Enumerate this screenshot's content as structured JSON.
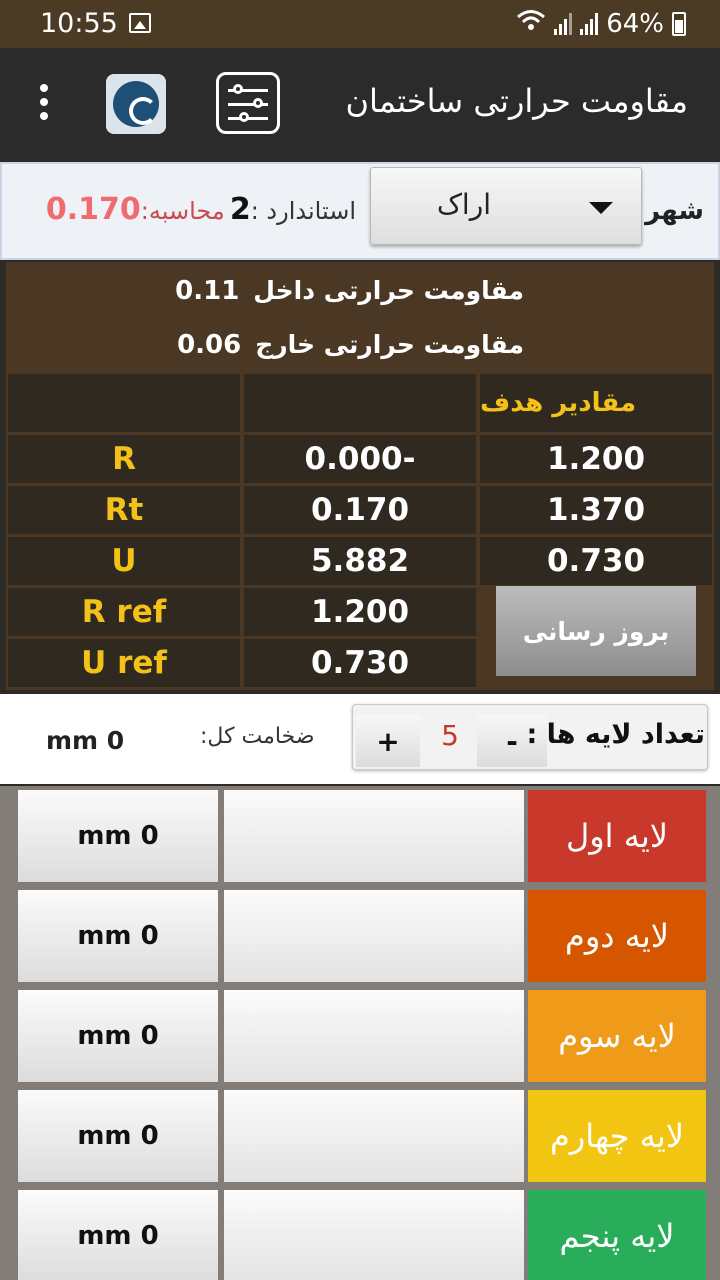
{
  "status": {
    "time": "10:55",
    "battery": "64%"
  },
  "app": {
    "title": "مقاومت حرارتی ساختمان"
  },
  "city": {
    "label": "شهر",
    "selected": "اراک"
  },
  "calc": {
    "standard_label": "استاندارد :",
    "standard_value": "2",
    "calc_label": "محاسبه:",
    "calc_value": "0.170"
  },
  "resistance": {
    "inner_label": "مقاومت حرارتی داخل",
    "inner_value": "0.11",
    "outer_label": "مقاومت حرارتی خارج",
    "outer_value": "0.06"
  },
  "table": {
    "target_header": "مقادیر هدف",
    "rows": [
      {
        "label": "R",
        "current": "0.000-",
        "target": "1.200"
      },
      {
        "label": "Rt",
        "current": "0.170",
        "target": "1.370"
      },
      {
        "label": "U",
        "current": "5.882",
        "target": "0.730"
      },
      {
        "label": "R ref",
        "current": "1.200"
      },
      {
        "label": "U ref",
        "current": "0.730"
      }
    ],
    "update_label": "بروز رسانی"
  },
  "layers_control": {
    "count_label": "تعداد لایه ها :",
    "count": "5",
    "plus": "+",
    "minus": "-",
    "thickness_label": "ضخامت کل:",
    "thickness_value": "mm 0"
  },
  "layers": [
    {
      "name": "لایه اول",
      "thickness": "mm 0",
      "color": "#c9392b"
    },
    {
      "name": "لایه دوم",
      "thickness": "mm 0",
      "color": "#d65600"
    },
    {
      "name": "لایه سوم",
      "thickness": "mm 0",
      "color": "#f09a1a"
    },
    {
      "name": "لایه چهارم",
      "thickness": "mm 0",
      "color": "#f2c512"
    },
    {
      "name": "لایه پنجم",
      "thickness": "mm 0",
      "color": "#2aad5a"
    }
  ]
}
